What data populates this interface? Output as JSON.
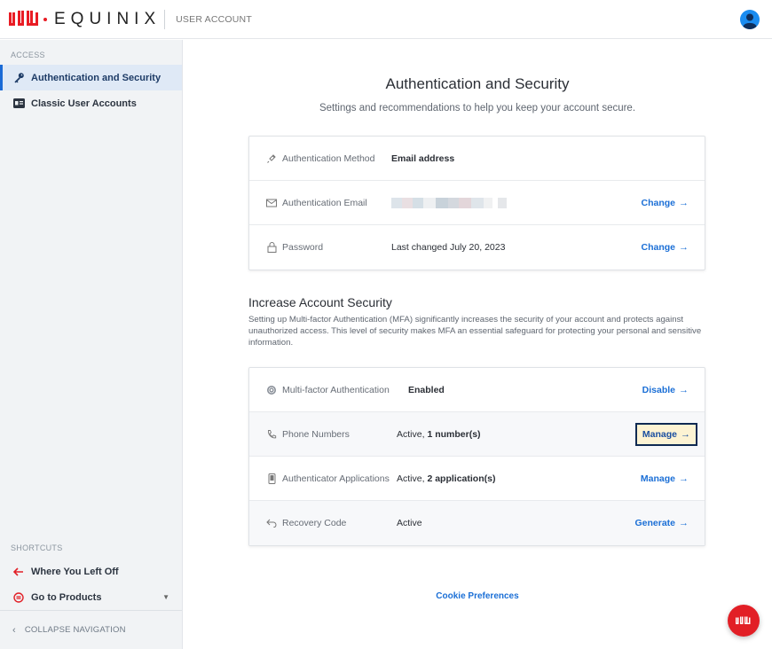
{
  "header": {
    "brand": "EQUINIX",
    "section": "USER ACCOUNT",
    "brand_color": "#e91c24"
  },
  "sidebar": {
    "access_label": "ACCESS",
    "items": [
      {
        "label": "Authentication and Security",
        "icon": "key-icon",
        "active": true
      },
      {
        "label": "Classic User Accounts",
        "icon": "id-card-icon",
        "active": false
      }
    ],
    "shortcuts_label": "SHORTCUTS",
    "shortcuts": [
      {
        "label": "Where You Left Off",
        "icon": "arrow-left-icon"
      },
      {
        "label": "Go to Products",
        "icon": "products-icon"
      }
    ],
    "collapse_label": "COLLAPSE NAVIGATION"
  },
  "main": {
    "title": "Authentication and Security",
    "subtitle": "Settings and recommendations to help you keep your account secure.",
    "auth_card": {
      "rows": [
        {
          "label": "Authentication Method",
          "icon": "link-icon",
          "value": "Email address",
          "action": ""
        },
        {
          "label": "Authentication Email",
          "icon": "envelope-icon",
          "value": "",
          "action": "Change"
        },
        {
          "label": "Password",
          "icon": "lock-icon",
          "value": "Last changed July 20, 2023",
          "action": "Change"
        }
      ]
    },
    "security": {
      "title": "Increase Account Security",
      "description": "Setting up Multi-factor Authentication (MFA) significantly increases the security of your account and protects against unauthorized access. This level of security makes MFA an essential safeguard for protecting your personal and sensitive information."
    },
    "mfa_card": {
      "rows": [
        {
          "label": "Multi-factor Authentication",
          "icon": "fingerprint-icon",
          "value_prefix": "",
          "value_bold": "Enabled",
          "action": "Disable"
        },
        {
          "label": "Phone Numbers",
          "icon": "phone-icon",
          "value_prefix": "Active, ",
          "value_bold": "1 number(s)",
          "action": "Manage"
        },
        {
          "label": "Authenticator Applications",
          "icon": "mobile-icon",
          "value_prefix": "Active, ",
          "value_bold": "2 application(s)",
          "action": "Manage"
        },
        {
          "label": "Recovery Code",
          "icon": "recovery-icon",
          "value_prefix": "Active",
          "value_bold": "",
          "action": "Generate"
        }
      ]
    },
    "cookie_link": "Cookie Preferences"
  },
  "colors": {
    "accent": "#1b6fd6",
    "sidebar_bg": "#f1f3f5",
    "active_bg": "#dfe9f6",
    "chat_button": "#e21f26"
  }
}
